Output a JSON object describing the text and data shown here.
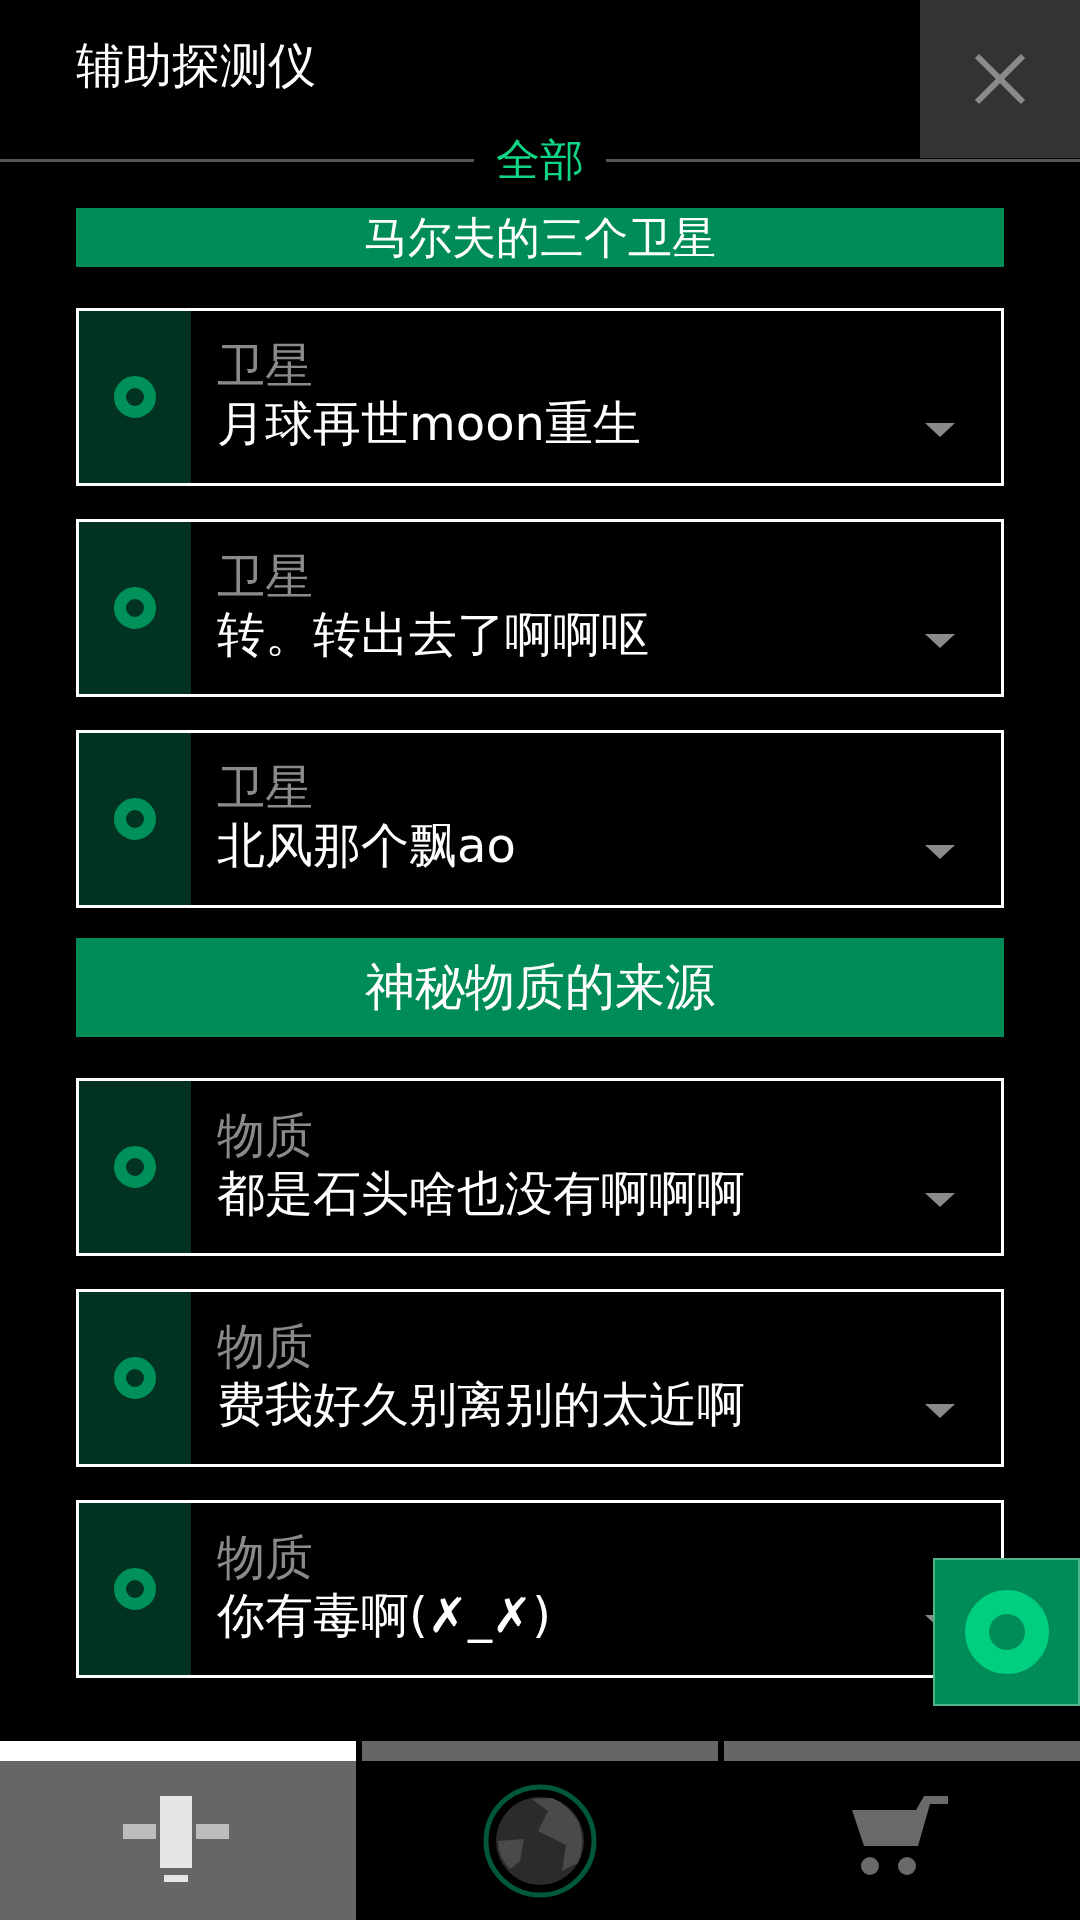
{
  "title": "辅助探测仪",
  "filter": "全部",
  "sections": [
    {
      "title": "马尔夫的三个卫星",
      "items": [
        {
          "category": "卫星",
          "value": "月球再世moon重生"
        },
        {
          "category": "卫星",
          "value": "转。转出去了啊啊呕"
        },
        {
          "category": "卫星",
          "value": "北风那个飘ao"
        }
      ]
    },
    {
      "title": "神秘物质的来源",
      "items": [
        {
          "category": "物质",
          "value": "都是石头啥也没有啊啊啊"
        },
        {
          "category": "物质",
          "value": "费我好久别离别的太近啊"
        },
        {
          "category": "物质",
          "value": "你有毒啊(✗_✗)"
        }
      ]
    }
  ],
  "nav": [
    {
      "kind": "probe",
      "selected": true
    },
    {
      "kind": "planet",
      "selected": false
    },
    {
      "kind": "cart",
      "selected": false
    }
  ]
}
